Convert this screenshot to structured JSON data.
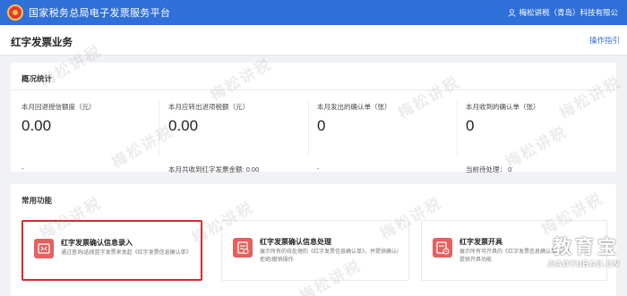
{
  "header": {
    "app_title": "国家税务总局电子发票服务平台",
    "user_name": "梅松讲税（青岛）科技有限公"
  },
  "page": {
    "title": "红字发票业务",
    "guide_link": "操作指引"
  },
  "overview": {
    "title": "概况统计",
    "stats": [
      {
        "label": "本月回退授信额度（元）",
        "value": "0.00",
        "sub": "-"
      },
      {
        "label": "本月应转出进项税额（元）",
        "value": "0.00",
        "sub": "本月共收到红字发票金额:  0.00"
      },
      {
        "label": "本月发出的确认单（张）",
        "value": "0",
        "sub": "-"
      },
      {
        "label": "本月收到的确认单（张）",
        "value": "0",
        "sub": "当前待处理：  0"
      }
    ]
  },
  "functions": {
    "title": "常用功能",
    "items": [
      {
        "title": "红字发票确认信息录入",
        "desc": "通过查询/选择蓝字发票来发起《红字发票信息确认单》",
        "icon": "invoice-entry-icon",
        "color": "#e05a5a"
      },
      {
        "title": "红字发票确认信息处理",
        "desc": "展示所有的待处理的《红字发票信息确认单》，并提供确认/拒绝/撤销操作",
        "icon": "invoice-process-icon",
        "color": "#e05a5a"
      },
      {
        "title": "红字发票开具",
        "desc": "展示所有可开具的《红字发票信息确认单》，并提供开具功能",
        "icon": "invoice-issue-icon",
        "color": "#e05a5a"
      }
    ]
  },
  "watermark": {
    "text": "梅松讲税"
  },
  "corner_logo": {
    "brand": "教育宝",
    "url": "JIAOYUBAO.CN"
  }
}
